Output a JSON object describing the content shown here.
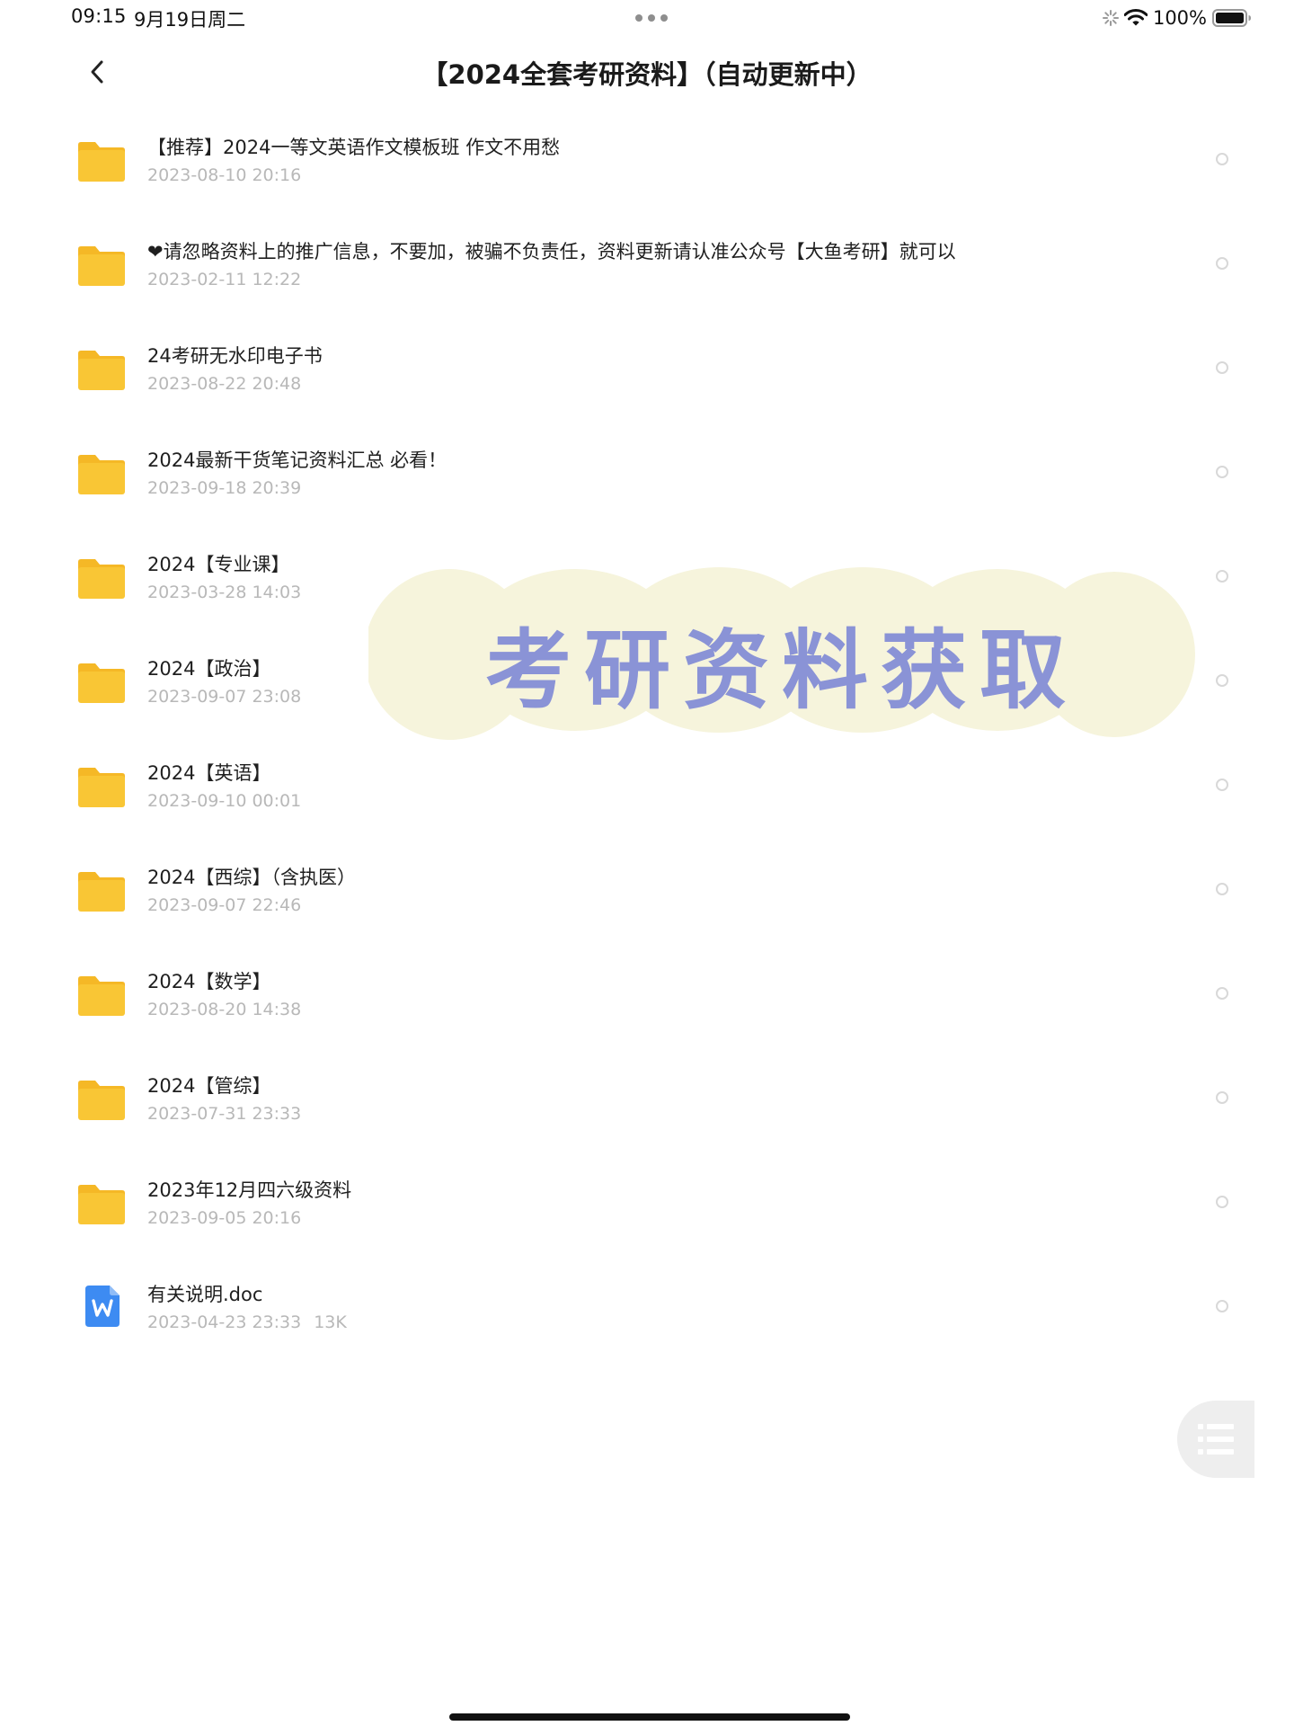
{
  "status_bar": {
    "time": "09:15",
    "date": "9月19日周二",
    "battery": "100%",
    "icons": [
      "loading-icon",
      "wifi-icon",
      "battery-icon"
    ]
  },
  "header": {
    "title": "【2024全套考研资料】（自动更新中）",
    "back_icon": "chevron-left-icon"
  },
  "files": [
    {
      "name": "【推荐】2024一等文英语作文模板班 作文不用愁",
      "date": "2023-08-10 20:16",
      "type": "folder",
      "size": ""
    },
    {
      "name": "❤请忽略资料上的推广信息，不要加，被骗不负责任，资料更新请认准公众号【大鱼考研】就可以",
      "date": "2023-02-11 12:22",
      "type": "folder",
      "size": ""
    },
    {
      "name": "24考研无水印电子书",
      "date": "2023-08-22 20:48",
      "type": "folder",
      "size": ""
    },
    {
      "name": "2024最新干货笔记资料汇总 必看！",
      "date": "2023-09-18 20:39",
      "type": "folder",
      "size": ""
    },
    {
      "name": "2024【专业课】",
      "date": "2023-03-28 14:03",
      "type": "folder",
      "size": ""
    },
    {
      "name": "2024【政治】",
      "date": "2023-09-07 23:08",
      "type": "folder",
      "size": ""
    },
    {
      "name": "2024【英语】",
      "date": "2023-09-10 00:01",
      "type": "folder",
      "size": ""
    },
    {
      "name": "2024【西综】（含执医）",
      "date": "2023-09-07 22:46",
      "type": "folder",
      "size": ""
    },
    {
      "name": "2024【数学】",
      "date": "2023-08-20 14:38",
      "type": "folder",
      "size": ""
    },
    {
      "name": "2024【管综】",
      "date": "2023-07-31 23:33",
      "type": "folder",
      "size": ""
    },
    {
      "name": "2023年12月四六级资料",
      "date": "2023-09-05 20:16",
      "type": "folder",
      "size": ""
    },
    {
      "name": "有关说明.doc",
      "date": "2023-04-23 23:33",
      "type": "doc",
      "size": "13K"
    }
  ],
  "watermark": {
    "text": "考研资料获取",
    "text_color": "#8a93d6",
    "cloud_color": "#f6f4dc"
  },
  "colors": {
    "folder": "#f9c635",
    "folder_tab": "#f5b826",
    "doc": "#3d8bf2",
    "meta_text": "#b8b8b8",
    "radio_border": "#d8d8d8"
  },
  "float_menu": {
    "icon": "list-icon"
  }
}
